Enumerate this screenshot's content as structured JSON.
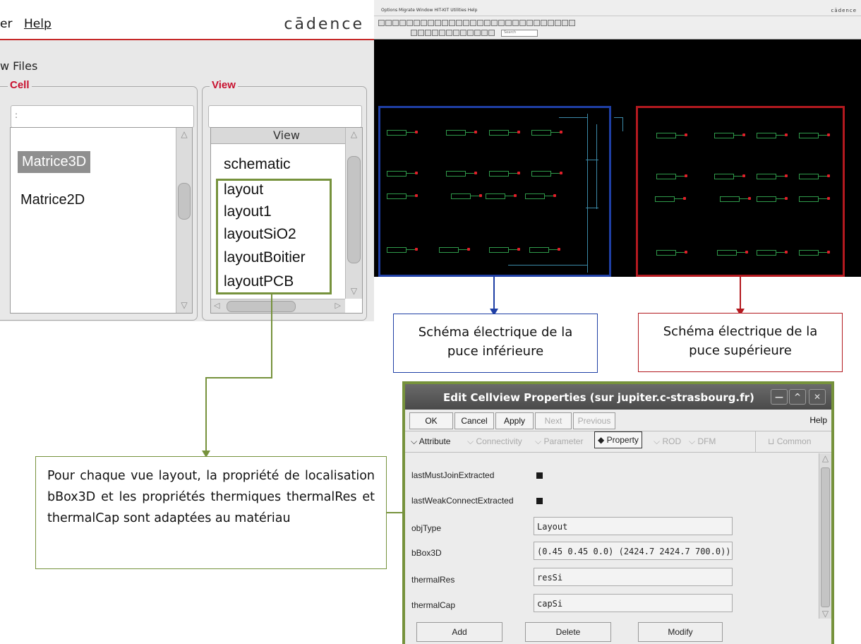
{
  "library_manager": {
    "menu_partial": "er",
    "menu_help": "Help",
    "logo": "cādence",
    "section_title": "w Files",
    "cell_group_label": "Cell",
    "view_group_label": "View",
    "cell_filter": ":",
    "view_header": "View",
    "cells": [
      "Matrice3D",
      "Matrice2D"
    ],
    "views": [
      "schematic",
      "layout",
      "layout1",
      "layoutSiO2",
      "layoutBoitier",
      "layoutPCB"
    ]
  },
  "schematic_window": {
    "menu": "Options  Migrate  Window  HIT-KIT Utilities  Help",
    "logo": "cādence",
    "search_placeholder": "Search"
  },
  "callouts": {
    "lower_chip": "Schéma électrique de la puce inférieure",
    "upper_chip": "Schéma électrique de la puce supérieure",
    "layout_note": "Pour chaque vue  layout, la propriété de localisation bBox3D et les propriétés thermiques thermalRes et thermalCap sont adaptées au matériau"
  },
  "colors": {
    "blue_frame": "#1f3fa5",
    "red_frame": "#b3191f",
    "green": "#76923c"
  },
  "dialog": {
    "title": "Edit Cellview Properties (sur jupiter.c-strasbourg.fr)",
    "buttons": {
      "ok": "OK",
      "cancel": "Cancel",
      "apply": "Apply",
      "next": "Next",
      "previous": "Previous",
      "help": "Help"
    },
    "tabs": {
      "attribute": "Attribute",
      "connectivity": "Connectivity",
      "parameter": "Parameter",
      "property": "Property",
      "roid": "ROD",
      "dfm": "DFM",
      "common": "Common"
    },
    "properties": [
      {
        "name": "lastMustJoinExtracted",
        "value": ""
      },
      {
        "name": "lastWeakConnectExtracted",
        "value": ""
      },
      {
        "name": "objType",
        "value": "Layout"
      },
      {
        "name": "bBox3D",
        "value": "(0.45 0.45 0.0) (2424.7 2424.7 700.0))"
      },
      {
        "name": "thermalRes",
        "value": "resSi"
      },
      {
        "name": "thermalCap",
        "value": "capSi"
      }
    ],
    "bottom_buttons": {
      "add": "Add",
      "delete": "Delete",
      "modify": "Modify"
    }
  }
}
